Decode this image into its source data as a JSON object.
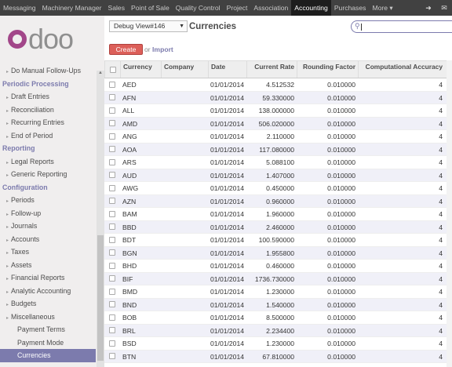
{
  "topnav": {
    "items": [
      {
        "label": "Messaging",
        "name": "menu-messaging"
      },
      {
        "label": "Machinery Manager",
        "name": "menu-machinery-manager"
      },
      {
        "label": "Sales",
        "name": "menu-sales"
      },
      {
        "label": "Point of Sale",
        "name": "menu-point-of-sale"
      },
      {
        "label": "Quality Control",
        "name": "menu-quality-control"
      },
      {
        "label": "Project",
        "name": "menu-project"
      },
      {
        "label": "Association",
        "name": "menu-association"
      },
      {
        "label": "Accounting",
        "name": "menu-accounting",
        "active": true
      },
      {
        "label": "Purchases",
        "name": "menu-purchases"
      },
      {
        "label": "More ▾",
        "name": "menu-more"
      }
    ],
    "icons": [
      "login-icon",
      "messages-icon"
    ]
  },
  "logo": {
    "text": "doo"
  },
  "sidebar": {
    "rows": [
      {
        "label": "Do Manual Follow-Ups",
        "type": "item"
      },
      {
        "label": "Periodic Processing",
        "type": "head"
      },
      {
        "label": "Draft Entries",
        "type": "item"
      },
      {
        "label": "Reconciliation",
        "type": "item"
      },
      {
        "label": "Recurring Entries",
        "type": "item"
      },
      {
        "label": "End of Period",
        "type": "item"
      },
      {
        "label": "Reporting",
        "type": "head"
      },
      {
        "label": "Legal Reports",
        "type": "item"
      },
      {
        "label": "Generic Reporting",
        "type": "item"
      },
      {
        "label": "Configuration",
        "type": "head"
      },
      {
        "label": "Periods",
        "type": "item"
      },
      {
        "label": "Follow-up",
        "type": "item"
      },
      {
        "label": "Journals",
        "type": "item"
      },
      {
        "label": "Accounts",
        "type": "item"
      },
      {
        "label": "Taxes",
        "type": "item"
      },
      {
        "label": "Assets",
        "type": "item"
      },
      {
        "label": "Financial Reports",
        "type": "item"
      },
      {
        "label": "Analytic Accounting",
        "type": "item"
      },
      {
        "label": "Budgets",
        "type": "item"
      },
      {
        "label": "Miscellaneous",
        "type": "item"
      },
      {
        "label": "Payment Terms",
        "type": "sub"
      },
      {
        "label": "Payment Mode",
        "type": "sub"
      },
      {
        "label": "Currencies",
        "type": "sub",
        "active": true
      }
    ]
  },
  "main": {
    "view_select": "Debug View#146",
    "title": "Currencies",
    "search_placeholder": "",
    "create_label": "Create",
    "or_text": "or",
    "import_label": "Import"
  },
  "table": {
    "columns": [
      "Currency",
      "Company",
      "Date",
      "Current Rate",
      "Rounding Factor",
      "Computational Accuracy"
    ],
    "rows": [
      [
        "AED",
        "",
        "01/01/2014",
        "4.512532",
        "0.010000",
        "4"
      ],
      [
        "AFN",
        "",
        "01/01/2014",
        "59.330000",
        "0.010000",
        "4"
      ],
      [
        "ALL",
        "",
        "01/01/2014",
        "138.000000",
        "0.010000",
        "4"
      ],
      [
        "AMD",
        "",
        "01/01/2014",
        "506.020000",
        "0.010000",
        "4"
      ],
      [
        "ANG",
        "",
        "01/01/2014",
        "2.110000",
        "0.010000",
        "4"
      ],
      [
        "AOA",
        "",
        "01/01/2014",
        "117.080000",
        "0.010000",
        "4"
      ],
      [
        "ARS",
        "",
        "01/01/2014",
        "5.088100",
        "0.010000",
        "4"
      ],
      [
        "AUD",
        "",
        "01/01/2014",
        "1.407000",
        "0.010000",
        "4"
      ],
      [
        "AWG",
        "",
        "01/01/2014",
        "0.450000",
        "0.010000",
        "4"
      ],
      [
        "AZN",
        "",
        "01/01/2014",
        "0.960000",
        "0.010000",
        "4"
      ],
      [
        "BAM",
        "",
        "01/01/2014",
        "1.960000",
        "0.010000",
        "4"
      ],
      [
        "BBD",
        "",
        "01/01/2014",
        "2.460000",
        "0.010000",
        "4"
      ],
      [
        "BDT",
        "",
        "01/01/2014",
        "100.590000",
        "0.010000",
        "4"
      ],
      [
        "BGN",
        "",
        "01/01/2014",
        "1.955800",
        "0.010000",
        "4"
      ],
      [
        "BHD",
        "",
        "01/01/2014",
        "0.460000",
        "0.010000",
        "4"
      ],
      [
        "BIF",
        "",
        "01/01/2014",
        "1736.730000",
        "0.010000",
        "4"
      ],
      [
        "BMD",
        "",
        "01/01/2014",
        "1.230000",
        "0.010000",
        "4"
      ],
      [
        "BND",
        "",
        "01/01/2014",
        "1.540000",
        "0.010000",
        "4"
      ],
      [
        "BOB",
        "",
        "01/01/2014",
        "8.500000",
        "0.010000",
        "4"
      ],
      [
        "BRL",
        "",
        "01/01/2014",
        "2.234400",
        "0.010000",
        "4"
      ],
      [
        "BSD",
        "",
        "01/01/2014",
        "1.230000",
        "0.010000",
        "4"
      ],
      [
        "BTN",
        "",
        "01/01/2014",
        "67.810000",
        "0.010000",
        "4"
      ]
    ]
  }
}
